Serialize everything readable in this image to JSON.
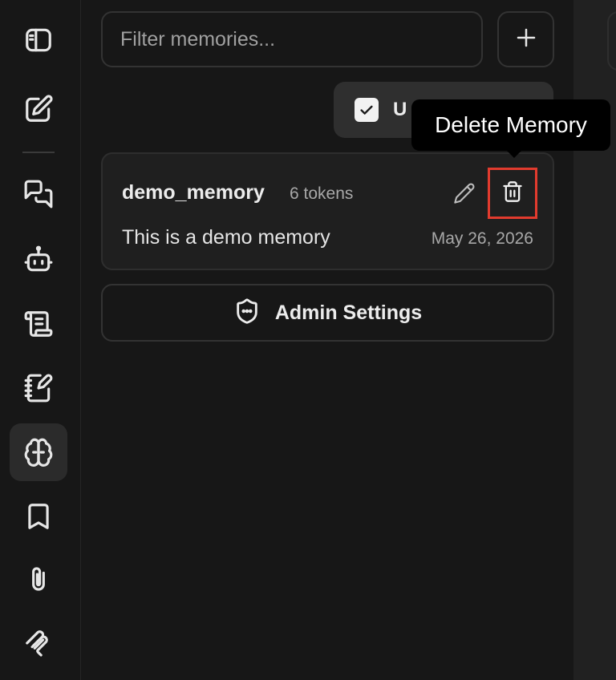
{
  "rail": {
    "items": [
      {
        "icon": "sidebar-toggle-icon"
      },
      {
        "icon": "new-chat-icon"
      },
      {
        "icon": "chats-icon"
      },
      {
        "icon": "agents-icon"
      },
      {
        "icon": "prompts-icon"
      },
      {
        "icon": "notebook-icon"
      },
      {
        "icon": "memories-icon",
        "active": true
      },
      {
        "icon": "bookmark-icon"
      },
      {
        "icon": "attachments-icon"
      },
      {
        "icon": "mcp-icon"
      }
    ]
  },
  "filter": {
    "placeholder": "Filter memories...",
    "value": ""
  },
  "add_button": {
    "icon": "plus-icon"
  },
  "toggle_chip": {
    "label": "U",
    "checked": true
  },
  "tooltip": {
    "text": "Delete Memory"
  },
  "memory": {
    "name": "demo_memory",
    "tokens": "6 tokens",
    "description": "This is a demo memory",
    "date": "May 26, 2026",
    "highlight_color": "#e23b2e"
  },
  "admin_button": {
    "label": "Admin Settings",
    "icon": "shield-icon"
  }
}
